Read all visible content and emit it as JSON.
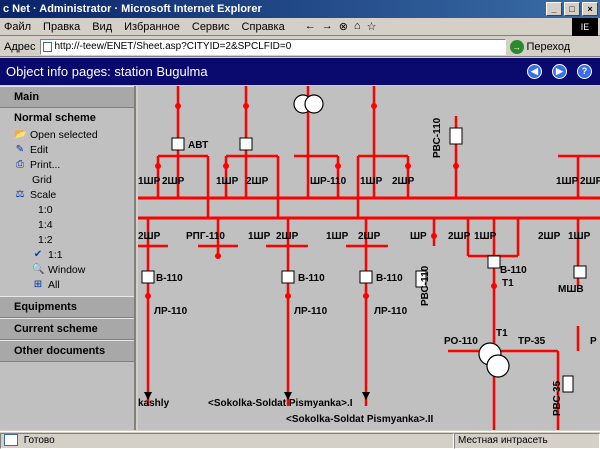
{
  "window": {
    "title": "c Net · Administrator · Microsoft Internet Explorer",
    "controls": [
      "_",
      "□",
      "×"
    ]
  },
  "menu": {
    "items": [
      "Файл",
      "Правка",
      "Вид",
      "Избранное",
      "Сервис",
      "Справка"
    ],
    "nav": [
      "←",
      "→",
      "⊗",
      "⌂",
      "☆"
    ]
  },
  "address": {
    "label": "Адрес",
    "value": "http://-teew/ENET/Sheet.asp?CITYID=2&SPCLFID=0",
    "go_label": "Переход"
  },
  "header": {
    "title": "Object info pages: station  Bugulma",
    "icons": [
      "back-icon",
      "forward-icon",
      "help-icon"
    ],
    "icon_glyphs": [
      "◀",
      "▶",
      "?"
    ]
  },
  "sidebar": {
    "main_label": "Main",
    "scheme_label": "Normal scheme",
    "items": [
      {
        "label": "Open selected",
        "icon": "folder-icon"
      },
      {
        "label": "Edit",
        "icon": "edit-icon"
      },
      {
        "label": "Print...",
        "icon": "print-icon"
      },
      {
        "label": "Grid",
        "icon": ""
      },
      {
        "label": "Scale",
        "icon": "scale-icon"
      }
    ],
    "scale_options": [
      "1:0",
      "1:4",
      "1:2",
      "1:1",
      "Window",
      "All"
    ],
    "scale_selected": "1:1",
    "sections": [
      "Equipments",
      "Current scheme",
      "Other documents"
    ]
  },
  "diagram": {
    "labels": {
      "abt": "АВТ",
      "rvs110_top": "РВС-110",
      "shr1": "1ШР",
      "shr2": "2ШР",
      "shr110": "ШР-110",
      "rpg110": "РПГ-110",
      "shr_single": "ШР",
      "v110": "В-110",
      "lr110": "ЛР-110",
      "rvs110_mid": "РВС-110",
      "t1": "Т1",
      "msv": "МШВ",
      "ro110": "РО-110",
      "tr35": "ТР-35",
      "rvs35": "РВС-35",
      "p": "Р",
      "kashly": "kashly",
      "line1": "<Sokolka-Soldat Pismyanka>.I",
      "line2": "<Sokolka-Soldat Pismyanka>.II"
    }
  },
  "status": {
    "left": "Готово",
    "right": "Местная интрасеть"
  },
  "colors": {
    "line_red": "#ff0000",
    "header_blue": "#0a0a6e",
    "panel_gray": "#c0c0c0"
  }
}
